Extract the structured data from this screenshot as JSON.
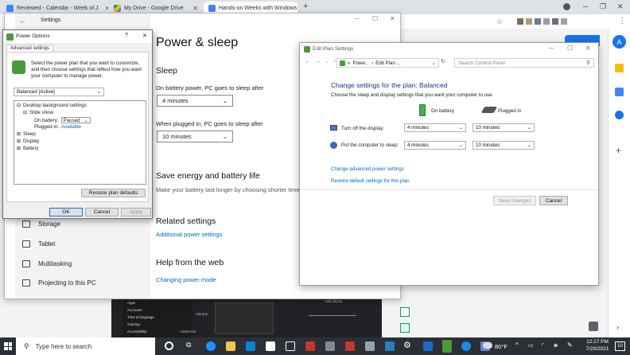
{
  "browser": {
    "tabs": [
      {
        "label": "Reviewed - Calendar - Week of J",
        "color": "#4285f4"
      },
      {
        "label": "My Drive - Google Drive",
        "color": "#0f9d58"
      },
      {
        "label": "Hands-on Weeks with Windows",
        "color": "#4285f4"
      }
    ],
    "new_tab": "+",
    "account_initial": "A",
    "account_color": "#1a73e8"
  },
  "settings": {
    "window_title": "Settings",
    "back_glyph": "←",
    "page_title": "Power & sleep",
    "sleep_heading": "Sleep",
    "battery_sleep_label": "On battery power, PC goes to sleep after",
    "battery_sleep_value": "4 minutes",
    "plugged_sleep_label": "When plugged in, PC goes to sleep after",
    "plugged_sleep_value": "10 minutes",
    "energy_heading": "Save energy and battery life",
    "energy_text": "Make your battery last longer by choosing shorter times",
    "related_heading": "Related settings",
    "related_link": "Additional power settings",
    "help_heading": "Help from the web",
    "help_link": "Changing power mode",
    "nav": [
      {
        "label": "Storage",
        "icon": "storage-icon"
      },
      {
        "label": "Tablet",
        "icon": "tablet-icon"
      },
      {
        "label": "Multitasking",
        "icon": "multitasking-icon"
      },
      {
        "label": "Projecting to this PC",
        "icon": "projector-icon"
      }
    ]
  },
  "power_options": {
    "title": "Power Options",
    "help": "?",
    "close": "✕",
    "tab": "Advanced settings",
    "description": "Select the power plan that you want to customize, and then choose settings that reflect how you want your computer to manage power.",
    "plan_select": "Balanced [Active]",
    "tree": {
      "desktop_bg": "Desktop background settings",
      "slide_show": "Slide show",
      "on_battery_label": "On battery:",
      "on_battery_value": "Paused",
      "plugged_in_label": "Plugged in:",
      "plugged_in_value": "Available",
      "sleep": "Sleep",
      "display": "Display",
      "battery": "Battery"
    },
    "restore_button": "Restore plan defaults",
    "ok": "OK",
    "cancel": "Cancel",
    "apply": "Apply"
  },
  "edit_plan": {
    "title": "Edit Plan Settings",
    "breadcrumb_1": "Powe...",
    "breadcrumb_2": "Edit Plan ...",
    "search_placeholder": "Search Control Panel",
    "heading": "Change settings for the plan: Balanced",
    "subheading": "Choose the sleep and display settings that you want your computer to use.",
    "col_battery": "On battery",
    "col_plugged": "Plugged in",
    "display_label": "Turn off the display:",
    "display_battery": "4 minutes",
    "display_plugged": "10 minutes",
    "sleep_label": "Put the computer to sleep:",
    "sleep_battery": "4 minutes",
    "sleep_plugged": "10 minutes",
    "link_advanced": "Change advanced power settings",
    "link_restore": "Restore default settings for this plan",
    "save_button": "Save changes",
    "cancel_button": "Cancel",
    "title_color": "#1e3287"
  },
  "background_app": {
    "items": [
      "Apps",
      "Accounts",
      "Time & language",
      "Gaming",
      "Accessibility"
    ],
    "volume": "Volume",
    "advanced": "Advanced",
    "device": "Add device"
  },
  "taskbar": {
    "search_placeholder": "Type here to search",
    "weather": "80°F",
    "time": "12:17 PM",
    "date": "7/20/2021",
    "notifications": "10"
  }
}
